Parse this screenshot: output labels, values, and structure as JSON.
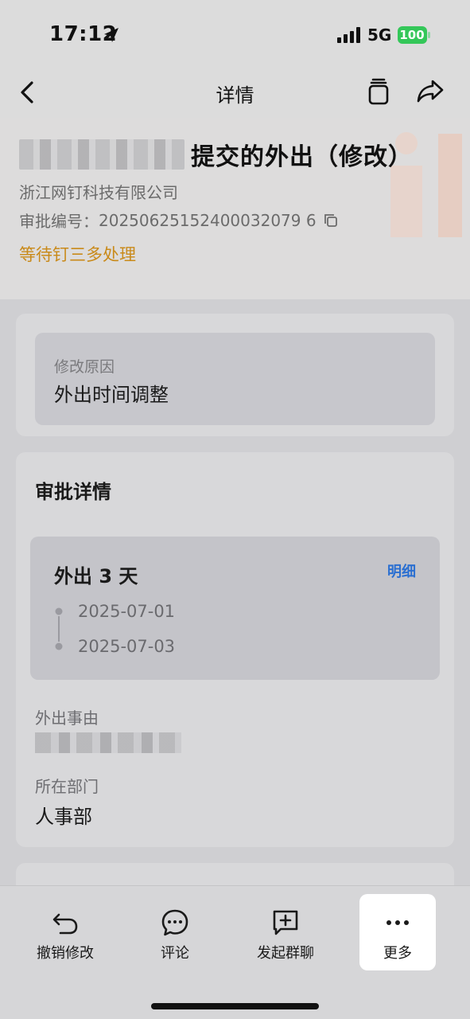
{
  "status_bar": {
    "time": "17:12",
    "network": "5G",
    "battery": "100",
    "battery_color": "#34c759"
  },
  "nav": {
    "title": "详情"
  },
  "header": {
    "title_suffix": "提交的外出（修改）",
    "company": "浙江网钉科技有限公司",
    "serial_label": "审批编号：",
    "serial_number": "20250625152400032079 6",
    "status": "等待钉三多处理",
    "status_color": "#c98a1a"
  },
  "reason_card": {
    "label": "修改原因",
    "value": "外出时间调整"
  },
  "detail_card": {
    "title": "审批详情",
    "trip_title": "外出 3 天",
    "detail_link": "明细",
    "date_start": "2025-07-01",
    "date_end": "2025-07-03",
    "reason_label": "外出事由",
    "dept_label": "所在部门",
    "dept_value": "人事部"
  },
  "actions": [
    {
      "label": "撤销修改",
      "icon": "undo-icon"
    },
    {
      "label": "评论",
      "icon": "comment-icon"
    },
    {
      "label": "发起群聊",
      "icon": "group-chat-icon"
    },
    {
      "label": "更多",
      "icon": "more-icon"
    }
  ]
}
